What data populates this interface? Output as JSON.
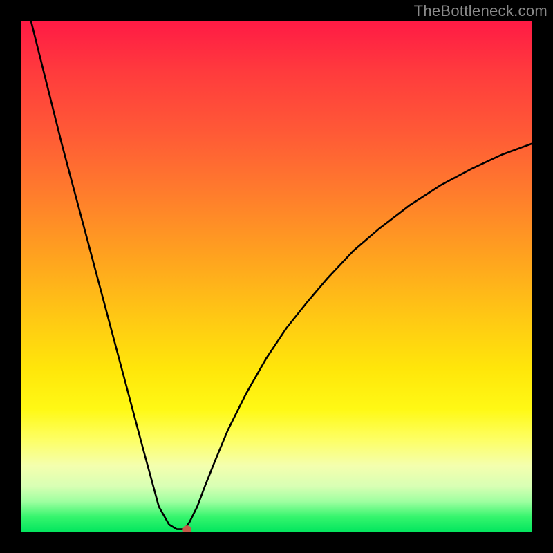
{
  "watermark": "TheBottleneck.com",
  "chart_data": {
    "type": "line",
    "title": "",
    "xlabel": "",
    "ylabel": "",
    "xlim": [
      0,
      100
    ],
    "ylim": [
      0,
      100
    ],
    "grid": false,
    "legend": false,
    "series": [
      {
        "name": "bottleneck-curve",
        "x": [
          2,
          5,
          8,
          12,
          16,
          20,
          24,
          27,
          29,
          30.5,
          32,
          33,
          34.5,
          36,
          38,
          40.5,
          44,
          48,
          52,
          56,
          60,
          65,
          70,
          76,
          82,
          88,
          94,
          100
        ],
        "y": [
          100,
          88,
          76,
          61,
          46,
          31,
          16,
          5,
          1.5,
          0.6,
          0.6,
          2,
          5,
          9,
          14,
          20,
          27,
          34,
          40,
          45,
          49.7,
          55,
          59.3,
          63.9,
          67.8,
          71,
          73.8,
          76
        ]
      }
    ],
    "marker": {
      "name": "optimal-point",
      "x": 32.5,
      "y": 0.5,
      "color": "#c35b49"
    },
    "background": "rainbow-vertical-gradient"
  }
}
